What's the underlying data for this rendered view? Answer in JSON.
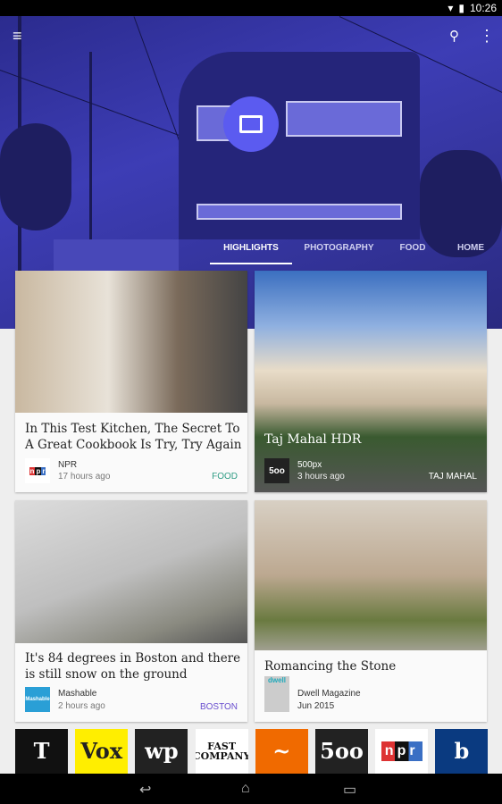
{
  "status_bar": {
    "time": "10:26"
  },
  "toolbar": {
    "menu_icon": "menu-icon",
    "search_icon": "search-icon",
    "overflow_icon": "more-vert-icon"
  },
  "tabs": [
    {
      "label": "HIGHLIGHTS",
      "active": true
    },
    {
      "label": "PHOTOGRAPHY"
    },
    {
      "label": "FOOD"
    },
    {
      "label": "HOME"
    }
  ],
  "cards": [
    {
      "title": "In This Test Kitchen, The Secret To A Great Cookbook Is Try, Try Again",
      "source": "NPR",
      "time": "17 hours ago",
      "tag": "FOOD",
      "tag_color": "#2e9c84"
    },
    {
      "title": "Taj Mahal HDR",
      "source": "500px",
      "time": "3 hours ago",
      "tag": "TAJ MAHAL",
      "logo": "5oo"
    },
    {
      "title": "It's 84 degrees in Boston and there is still snow on the ground",
      "source": "Mashable",
      "time": "2 hours ago",
      "tag": "BOSTON",
      "tag_color": "#6a4fcf",
      "logo": "Mashable"
    },
    {
      "title": "Romancing the Stone",
      "source": "Dwell Magazine",
      "time": "Jun 2015",
      "logo": "dwell"
    }
  ],
  "publications": [
    {
      "name": "T",
      "bg": "#111111",
      "fg": "#ffffff"
    },
    {
      "name": "Vox",
      "bg": "#ffee00",
      "fg": "#222222"
    },
    {
      "name": "wp",
      "bg": "#222222",
      "fg": "#ffffff"
    },
    {
      "name": "FAST COMPANY",
      "bg": "#ffffff",
      "fg": "#111111"
    },
    {
      "name": "~",
      "bg": "#f06a00",
      "fg": "#ffffff"
    },
    {
      "name": "5oo",
      "bg": "#222222",
      "fg": "#ffffff"
    },
    {
      "name": "npr",
      "bg": "#ffffff",
      "fg": "#ffffff"
    },
    {
      "name": "b",
      "bg": "#0a3a80",
      "fg": "#ffffff"
    }
  ],
  "nav": {
    "back": "back-icon",
    "home": "home-icon",
    "recents": "recents-icon"
  },
  "colors": {
    "header": "#3535a8",
    "fab": "#5b5bf0"
  }
}
